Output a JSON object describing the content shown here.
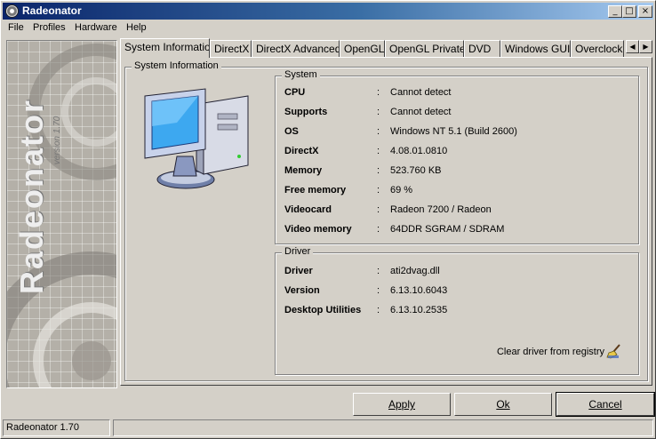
{
  "window": {
    "title": "Radeonator",
    "buttons": {
      "minimize": "_",
      "maximize": "□",
      "close": "×"
    }
  },
  "menu": [
    "File",
    "Profiles",
    "Hardware",
    "Help"
  ],
  "banner": {
    "name": "Radeonator",
    "version": "version 1.70"
  },
  "tabs": [
    "System Information",
    "DirectX",
    "DirectX Advanced",
    "OpenGL",
    "OpenGL Private",
    "DVD",
    "Windows GUI",
    "Overclocking"
  ],
  "tab_scroll": {
    "left": "◀",
    "right": "▶"
  },
  "panel": {
    "title": "System Information",
    "system_group": {
      "title": "System",
      "rows": [
        {
          "label": "CPU",
          "sep": ":",
          "value": "Cannot detect"
        },
        {
          "label": "Supports",
          "sep": ":",
          "value": "Cannot detect"
        },
        {
          "label": "OS",
          "sep": ":",
          "value": "Windows NT 5.1 (Build 2600)"
        },
        {
          "label": "DirectX",
          "sep": ":",
          "value": "4.08.01.0810"
        },
        {
          "label": "Memory",
          "sep": ":",
          "value": "523.760 KB"
        },
        {
          "label": "Free memory",
          "sep": ":",
          "value": "69 %"
        },
        {
          "label": "Videocard",
          "sep": ":",
          "value": "Radeon 7200 / Radeon"
        },
        {
          "label": "Video memory",
          "sep": ":",
          "value": "64DDR SGRAM / SDRAM"
        }
      ]
    },
    "driver_group": {
      "title": "Driver",
      "rows": [
        {
          "label": "Driver",
          "sep": ":",
          "value": "ati2dvag.dll"
        },
        {
          "label": "Version",
          "sep": ":",
          "value": "6.13.10.6043"
        },
        {
          "label": "Desktop Utilities",
          "sep": ":",
          "value": "6.13.10.2535"
        }
      ],
      "clear_link": "Clear driver from registry"
    }
  },
  "buttons": {
    "apply": "Apply",
    "ok": "Ok",
    "cancel": "Cancel"
  },
  "statusbar": {
    "text": "Radeonator 1.70",
    "pane2": ""
  }
}
